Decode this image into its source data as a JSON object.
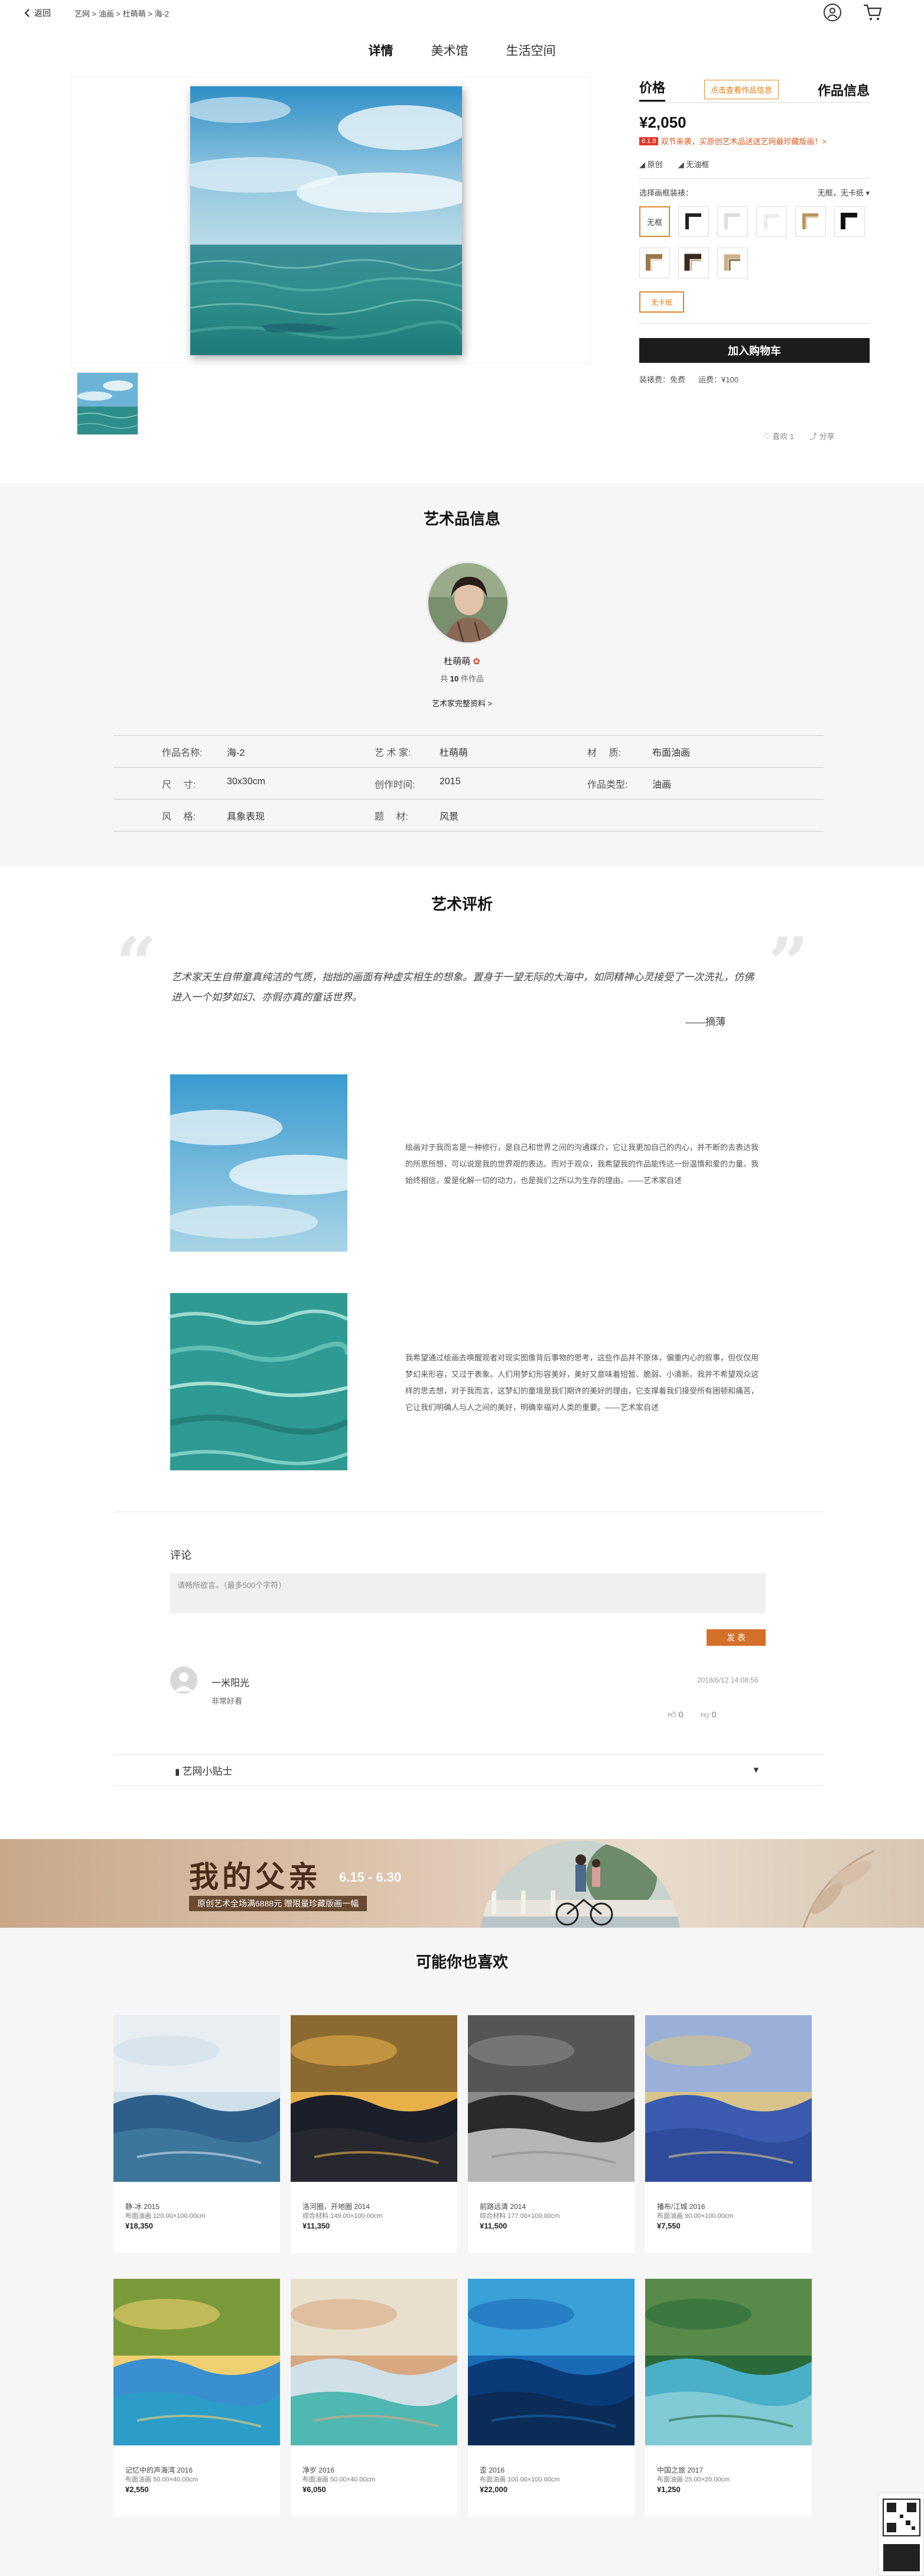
{
  "header": {
    "back_label": "返回",
    "breadcrumb": "艺网 > 油画 > 杜萌萌 > 海-2"
  },
  "tabs": [
    "详情",
    "美术馆",
    "生活空间"
  ],
  "panel": {
    "tab_price": "价格",
    "tab_button": "点击查看作品信息",
    "tab_info": "作品信息",
    "price": "¥2,050",
    "promo_tag": "6.1.8",
    "promo_text": "双节来袭，买原创艺术品送送艺网最珍藏版画！>",
    "opt1": "原创",
    "opt2": "无油框",
    "frame_label": "选择画框装裱：",
    "frame_value": "无框，无卡纸",
    "frame_none": "无框",
    "mount_label": "无卡纸",
    "cart_label": "加入购物车",
    "ship_fee": "装裱费：免费",
    "freight": "运费：¥100"
  },
  "social": {
    "like": "喜欢 1",
    "share": "分享"
  },
  "info": {
    "title": "艺术品信息",
    "artist_name": "杜萌萌",
    "artist_count_prefix": "共",
    "artist_count": "10",
    "artist_count_suffix": "件作品",
    "artist_link": "艺术家完整资料 >",
    "rows": [
      [
        {
          "k": "作品名称:",
          "v": "海-2"
        },
        {
          "k": "艺 术 家:",
          "v": "杜萌萌"
        },
        {
          "k": "材　 质:",
          "v": "布面油画"
        }
      ],
      [
        {
          "k": "尺　 寸:",
          "v": "30x30cm"
        },
        {
          "k": "创作时间:",
          "v": "2015"
        },
        {
          "k": "作品类型:",
          "v": "油画"
        }
      ],
      [
        {
          "k": "风　 格:",
          "v": "具象表现"
        },
        {
          "k": "题　 材:",
          "v": "风景"
        },
        {
          "k": "",
          "v": ""
        }
      ]
    ]
  },
  "review": {
    "title": "艺术评析",
    "quote": "艺术家天生自带童真纯洁的气质，拙拙的画面有种虚实相生的想象。置身于一望无际的大海中，如同精神心灵接受了一次洗礼，仿佛进入一个如梦如幻、亦假亦真的童话世界。",
    "quote_author": "——摘薄",
    "para1": "绘画对于我而言是一种修行，是自己和世界之间的沟通媒介，它让我更加自己的内心，并不断的去表达我的所思所想，可以说是我的世界观的表达。而对于观众，我希望我的作品能传达一份温情和爱的力量。我始终相信，爱是化解一切的动力，也是我们之所以为生存的理由。——艺术家自述",
    "para2": "我希望通过绘画去唤醒观者对现实图像背后事物的思考，这些作品并不原体，偏重内心的叙事，但仅仅用梦幻来形容，又过于表象。人们用梦幻形容美好，美好又意味着短暂、脆弱、小清新。我并不希望观众这样的思去想，对于我而言，这梦幻的童境是我们期许的美好的理由，它支撑着我们接受所有困顿和痛苦，它让我们明确人与人之间的美好，明确幸福对人类的重要。——艺术家自述"
  },
  "comment": {
    "label": "评论",
    "placeholder": "请畅所欲言。（最多500个字符）",
    "send": "发 表",
    "user": "一米阳光",
    "text": "非常好看",
    "time": "2018/6/12 14:08:56",
    "up": "0",
    "down": "0"
  },
  "tips": {
    "label": "艺网小贴士",
    "toggle": "▾"
  },
  "banner": {
    "title": "我的父亲",
    "date": "6.15 - 6.30",
    "sub": "原创艺术全场满6888元 赠限量珍藏版画一幅"
  },
  "recommend": {
    "title": "可能你也喜欢",
    "items": [
      {
        "t": "静-冰 2015",
        "s": "布面油画  120.00×100.00cm",
        "p": "¥18,350"
      },
      {
        "t": "洛河圈，开地圈 2014",
        "s": "综合材料  149.00×100.00cm",
        "p": "¥11,350"
      },
      {
        "t": "前路远清 2014",
        "s": "综合材料  177.00×100.00cm",
        "p": "¥11,500"
      },
      {
        "t": "播布/江城 2016",
        "s": "布面油画  90.00×100.00cm",
        "p": "¥7,550"
      },
      {
        "t": "记忆中的声海湾 2016",
        "s": "布面油画  50.00×40.00cm",
        "p": "¥2,550"
      },
      {
        "t": "净岁 2016",
        "s": "布面油画  50.00×40.00cm",
        "p": "¥6,050"
      },
      {
        "t": "歪 2016",
        "s": "布面油画  100.00×100.00cm",
        "p": "¥22,000"
      },
      {
        "t": "中国之旅 2017",
        "s": "布面油画  25.00×20.00cm",
        "p": "¥1,250"
      }
    ]
  },
  "colors": {
    "accent": "#e08a2a",
    "dark_button": "#1c1c1c",
    "send": "#d4702a"
  }
}
